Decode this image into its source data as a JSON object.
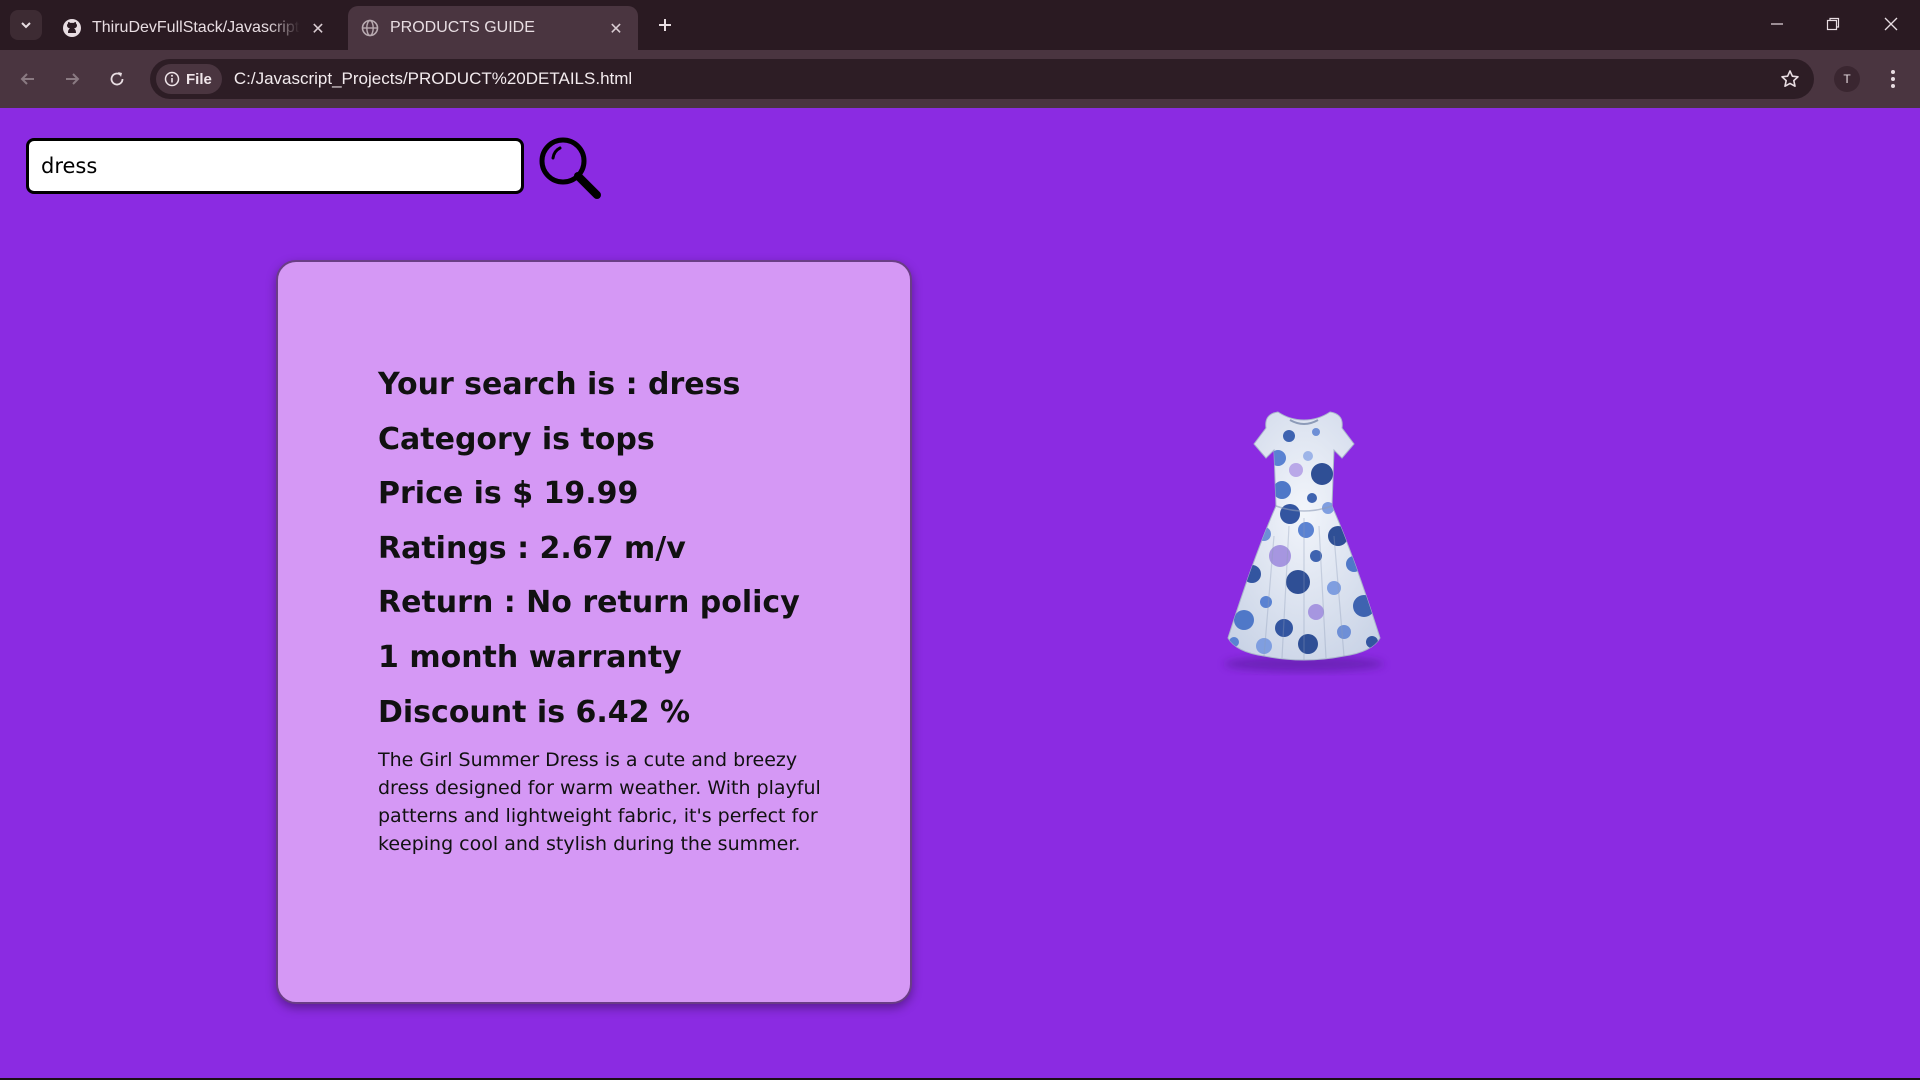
{
  "browser": {
    "tabs": [
      {
        "title": "ThiruDevFullStack/Javascript-pr",
        "active": false,
        "icon": "github-icon"
      },
      {
        "title": "PRODUCTS GUIDE",
        "active": true,
        "icon": "globe-icon"
      }
    ],
    "site_chip": "File",
    "url": "C:/Javascript_Projects/PRODUCT%20DETAILS.html",
    "profile_initial": "T"
  },
  "search": {
    "value": "dress"
  },
  "product": {
    "search_line": "Your search is : dress",
    "category_line": "Category is tops",
    "price_line": "Price is $ 19.99",
    "ratings_line": "Ratings : 2.67 m/v",
    "return_line": "Return : No return policy",
    "warranty_line": "1 month warranty",
    "discount_line": "Discount is 6.42 %",
    "description": "The Girl Summer Dress is a cute and breezy dress designed for warm weather. With playful patterns and lightweight fabric, it's perfect for keeping cool and stylish during the summer."
  },
  "colors": {
    "page_bg": "#8b2be2",
    "card_bg": "#d598f5"
  }
}
